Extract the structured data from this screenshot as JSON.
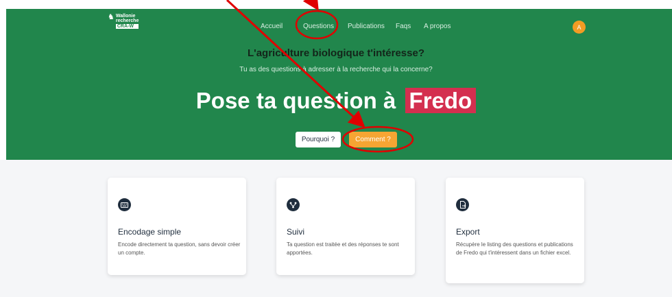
{
  "header": {
    "logo": {
      "line1": "Wallonie",
      "line2": "recherche",
      "line3": "CRA-W"
    },
    "nav": [
      {
        "label": "Accueil"
      },
      {
        "label": "Questions"
      },
      {
        "label": "Publications"
      },
      {
        "label": "Faqs"
      },
      {
        "label": "A propos"
      }
    ],
    "avatar_initial": "A"
  },
  "hero": {
    "headline": "L'agriculture biologique t'intéresse?",
    "subline": "Tu as des questions à adresser à la recherche qui la concerne?",
    "title_prefix": "Pose ta question à",
    "title_name": "Fredo",
    "buttons": {
      "why": "Pourquoi ?",
      "how": "Comment ?"
    }
  },
  "features": [
    {
      "title": "Encodage simple",
      "description": "Encode directement ta question, sans devoir créer un compte."
    },
    {
      "title": "Suivi",
      "description": "Ta question est traitée et des réponses te sont apportées."
    },
    {
      "title": "Export",
      "description": "Récupère le listing des questions et publications de Fredo qui t'intéressent dans un fichier excel."
    }
  ],
  "colors": {
    "hero_green": "#21864c",
    "accent_red": "#d42f4f",
    "accent_orange": "#f6a533",
    "annotation_red": "#e00000"
  }
}
